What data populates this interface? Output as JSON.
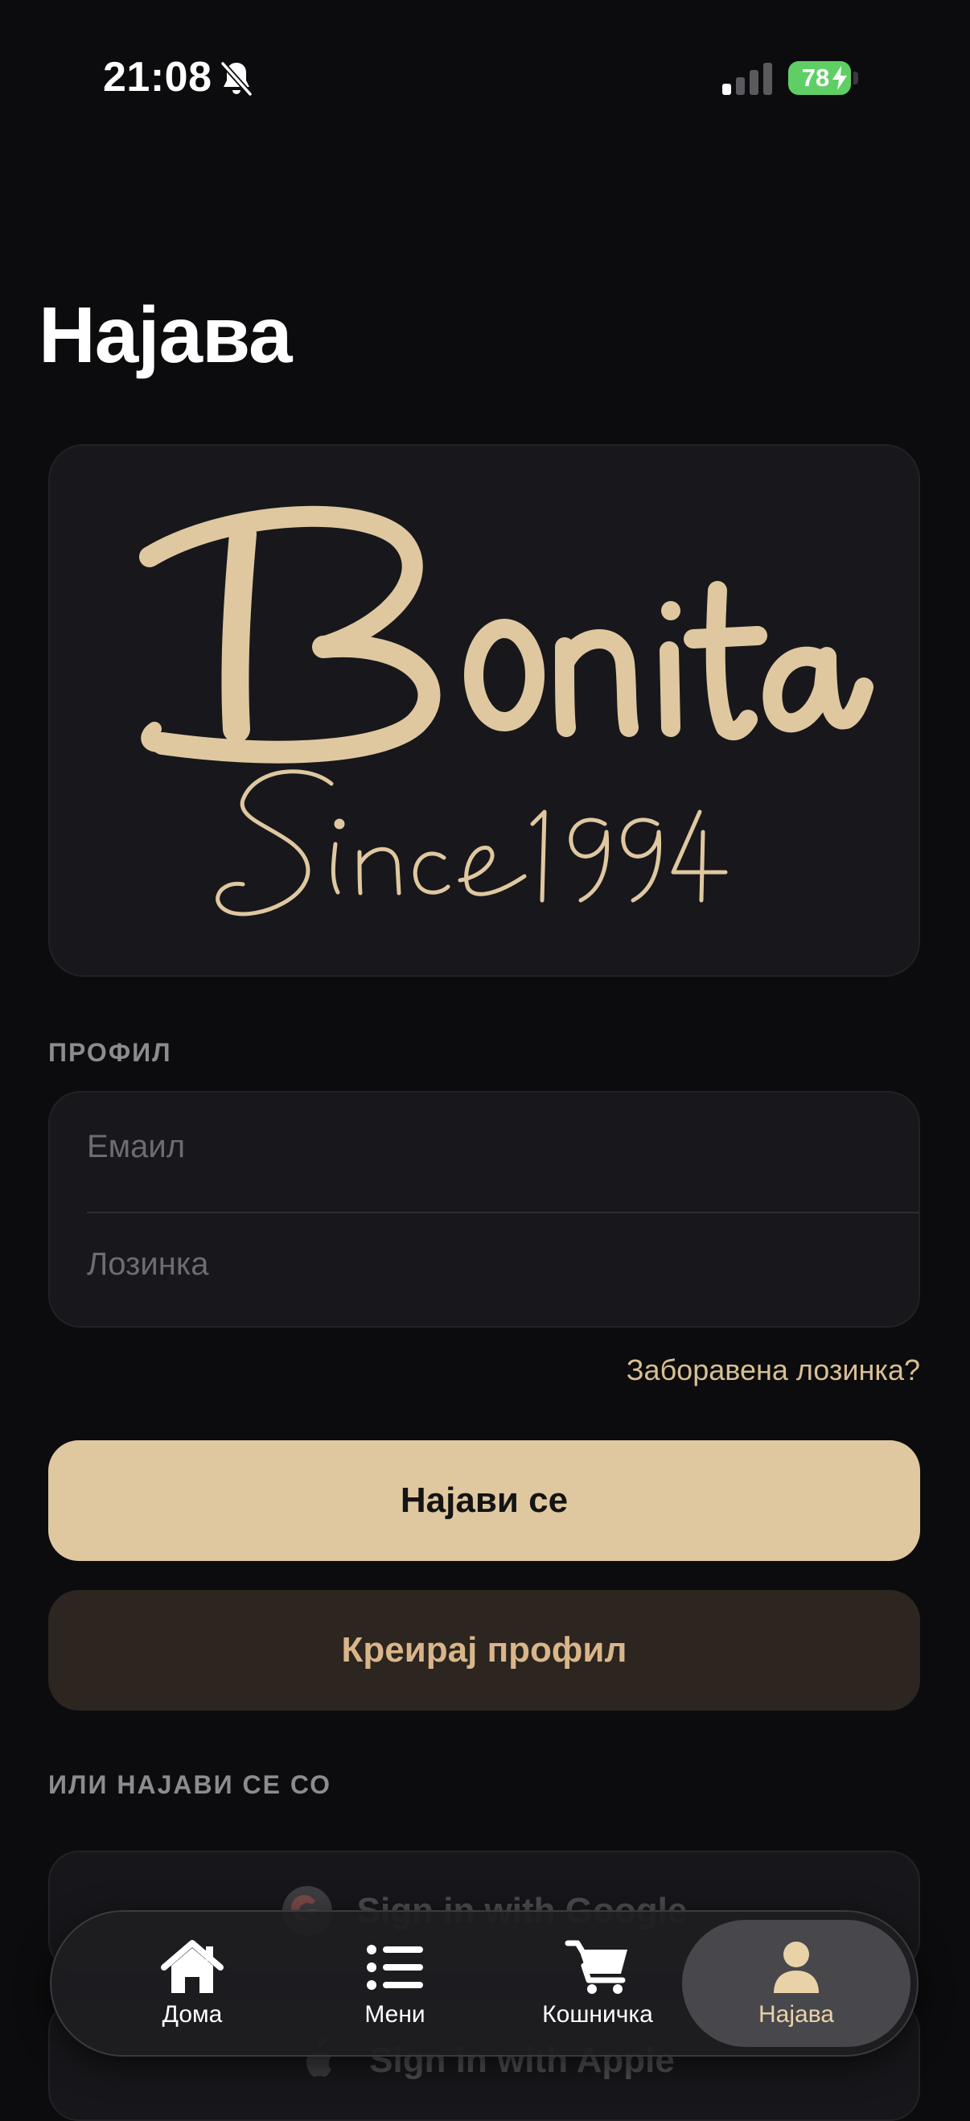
{
  "status_bar": {
    "time": "21:08",
    "battery_level": "78",
    "icons": [
      "bell-slash-icon",
      "signal-icon",
      "battery-icon",
      "bolt-icon"
    ]
  },
  "page": {
    "title": "Најава"
  },
  "logo": {
    "brand": "Bonita",
    "tagline": "Since1994",
    "color": "#dfc8a0"
  },
  "profile_section": {
    "label": "ПРОФИЛ",
    "email_placeholder": "Емаил",
    "email_value": "",
    "password_placeholder": "Лозинка",
    "password_value": ""
  },
  "forgot_password": "Заборавена лозинка?",
  "buttons": {
    "login": "Најави се",
    "register": "Креирај профил"
  },
  "alt_section": {
    "label": "ИЛИ НАЈАВИ СЕ СО",
    "google": "Sign in with Google",
    "apple": "Sign in with Apple"
  },
  "tab_bar": {
    "items": [
      {
        "label": "Дома",
        "icon": "home-icon"
      },
      {
        "label": "Мени",
        "icon": "list-icon"
      },
      {
        "label": "Кошничка",
        "icon": "cart-icon"
      },
      {
        "label": "Најава",
        "icon": "person-icon",
        "active": true
      }
    ]
  },
  "colors": {
    "background": "#0c0c0e",
    "accent": "#dfc8a0",
    "card": "#18171b",
    "battery": "#5fcf65"
  }
}
